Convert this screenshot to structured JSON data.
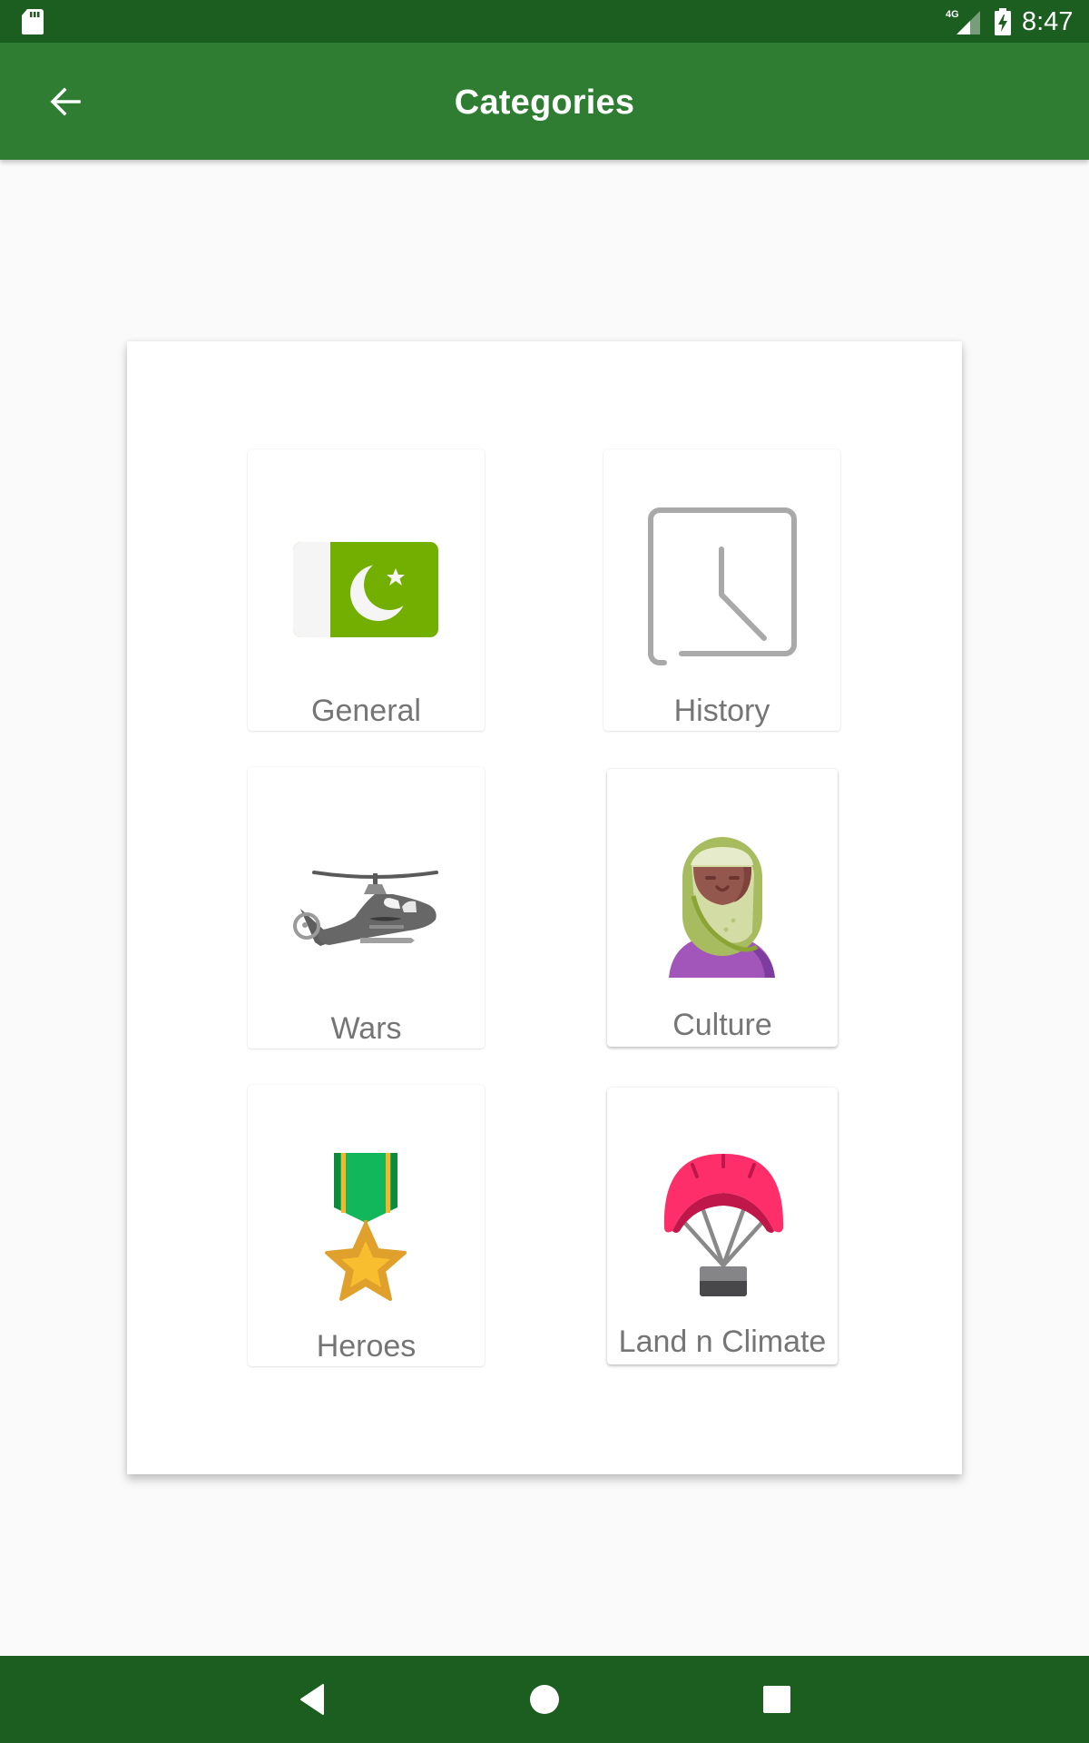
{
  "status_bar": {
    "time": "8:47",
    "network_type": "4G",
    "icons": [
      "sd-card-icon",
      "signal-4g-icon",
      "battery-charging-icon"
    ]
  },
  "app_bar": {
    "title": "Categories",
    "back_icon": "arrow-back-icon"
  },
  "categories": [
    {
      "label": "General",
      "icon": "pakistan-flag-icon"
    },
    {
      "label": "History",
      "icon": "clock-icon"
    },
    {
      "label": "Wars",
      "icon": "helicopter-icon"
    },
    {
      "label": "Culture",
      "icon": "woman-hijab-icon"
    },
    {
      "label": "Heroes",
      "icon": "medal-star-icon"
    },
    {
      "label": "Land n Climate",
      "icon": "parachute-icon"
    }
  ],
  "nav_bar": {
    "buttons": [
      "back-triangle-icon",
      "home-circle-icon",
      "recents-square-icon"
    ]
  },
  "colors": {
    "status_bar": "#1B5E20",
    "app_bar": "#2E7D32",
    "background": "#FAFAFA",
    "label_text": "#757575"
  }
}
